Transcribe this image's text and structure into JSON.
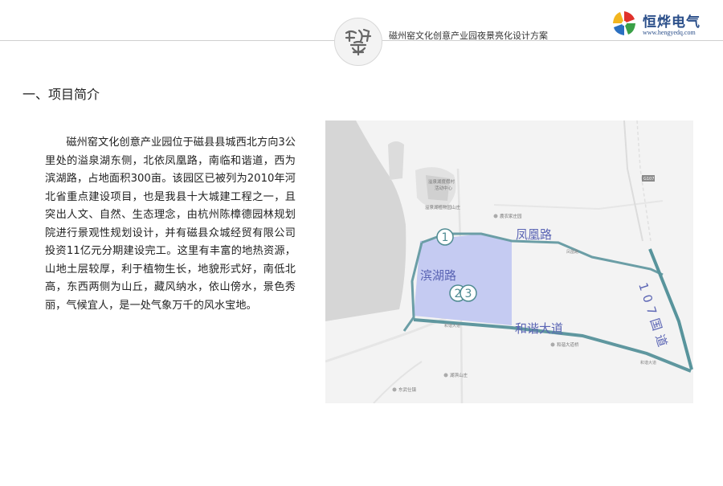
{
  "header": {
    "seal_text": "磁州窑",
    "title": "磁州窑文化创意产业园夜景亮化设计方案",
    "brand_name": "恒烨电气",
    "brand_url": "www.hengyedq.com"
  },
  "section": {
    "title": "一、项目简介"
  },
  "intro": {
    "text": "磁州窑文化创意产业园位于磁县县城西北方向3公里处的溢泉湖东侧，北依凤凰路，南临和谐道，西为滨湖路，占地面积300亩。该园区已被列为2010年河北省重点建设项目，也是我县十大城建工程之一，且突出人文、自然、生态理念，由杭州陈樟德园林规划院进行景观性规划设计，并有磁县众城经贸有限公司投资11亿元分期建设完工。这里有丰富的地热资源，山地土层较厚，利于植物生长，地貌形式好，南低北高，东西两侧为山丘，藏风纳水，依山傍水，景色秀丽，气候宜人，是一处气象万千的风水宝地。"
  },
  "map": {
    "road_labels": {
      "fenghuang": "凤凰路",
      "binhu": "滨湖路",
      "hexie": "和谐大道",
      "g107": "107国道"
    },
    "markers": {
      "m1": "1",
      "m2": "2",
      "m3": "3"
    },
    "poi_labels": {
      "hot_spring": "溢泉湖度假村",
      "activity_center": "活动中心",
      "plant_garden": "溢泉湖植物园山庄",
      "nongjia": "農农家庄园",
      "hexie_bridge": "和谐大道桥",
      "lakeside_villa": "湖滨山庄",
      "dongwu": "东武仕镇",
      "g107_tag": "G107",
      "fenghuang_small": "凤凰路",
      "hexie_small": "和谐大道",
      "hexie_small_2": "和谐大道"
    },
    "colors": {
      "site_fill": "#c5cbf2",
      "boundary": "#6b9ea6",
      "road_label": "#5a64b4",
      "highway": "#58949c"
    }
  }
}
